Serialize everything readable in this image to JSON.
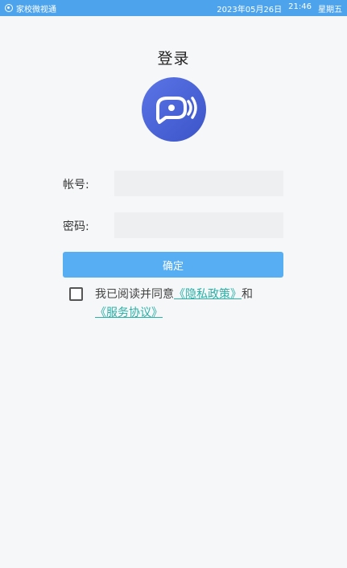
{
  "status_bar": {
    "app_name": "家校微视通",
    "date": "2023年05月26日",
    "time": "21:46",
    "weekday": "星期五"
  },
  "page": {
    "title": "登录"
  },
  "form": {
    "account_label": "帐号:",
    "account_value": "",
    "password_label": "密码:",
    "password_value": "",
    "confirm_label": "确定"
  },
  "agreement": {
    "prefix": "我已阅读并同意",
    "privacy_link": "《隐私政策》",
    "connector": "和",
    "service_link": "《服务协议》",
    "checked": false
  },
  "icons": {
    "status_app": "camera-icon",
    "logo": "chat-bubble-logo-icon"
  },
  "colors": {
    "status_bar": "#4da4ec",
    "primary_button": "#57aef2",
    "link": "#2bb0a6",
    "logo_start": "#5b74e6",
    "logo_end": "#3b55c9"
  }
}
